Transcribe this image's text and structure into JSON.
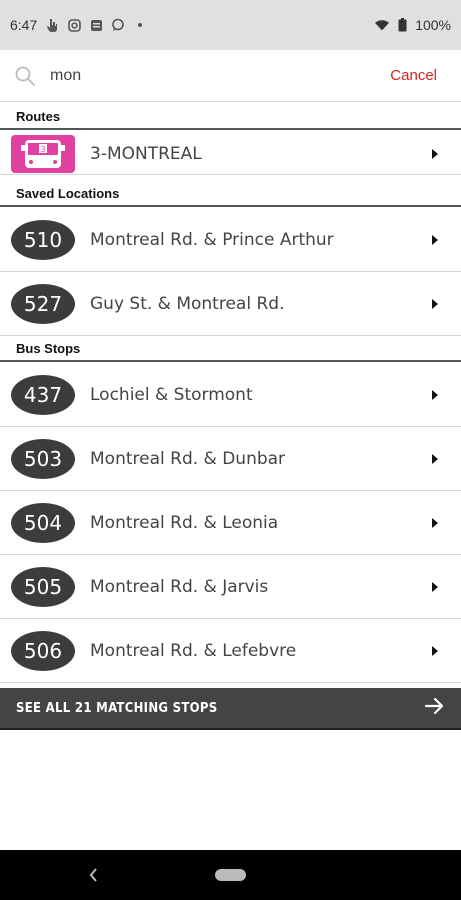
{
  "status_bar": {
    "time": "6:47",
    "battery": "100%"
  },
  "search": {
    "value": "mon",
    "cancel_label": "Cancel"
  },
  "sections": {
    "routes": "Routes",
    "saved_locations": "Saved Locations",
    "bus_stops": "Bus Stops"
  },
  "routes": [
    {
      "badge_number": "3",
      "label": "3-MONTREAL",
      "badge_color": "#e040a0"
    }
  ],
  "saved_locations": [
    {
      "number": "510",
      "label": "Montreal Rd. & Prince Arthur"
    },
    {
      "number": "527",
      "label": "Guy St. & Montreal Rd."
    }
  ],
  "bus_stops": [
    {
      "number": "437",
      "label": "Lochiel & Stormont"
    },
    {
      "number": "503",
      "label": "Montreal Rd. & Dunbar"
    },
    {
      "number": "504",
      "label": "Montreal Rd. & Leonia"
    },
    {
      "number": "505",
      "label": "Montreal Rd. & Jarvis"
    },
    {
      "number": "506",
      "label": "Montreal Rd. & Lefebvre"
    }
  ],
  "see_all": {
    "label": "SEE ALL 21 MATCHING STOPS",
    "icon": "arrow-right-icon"
  },
  "colors": {
    "accent_cancel": "#e02020",
    "pill": "#3c3c3c",
    "see_all_bar": "#444444"
  }
}
